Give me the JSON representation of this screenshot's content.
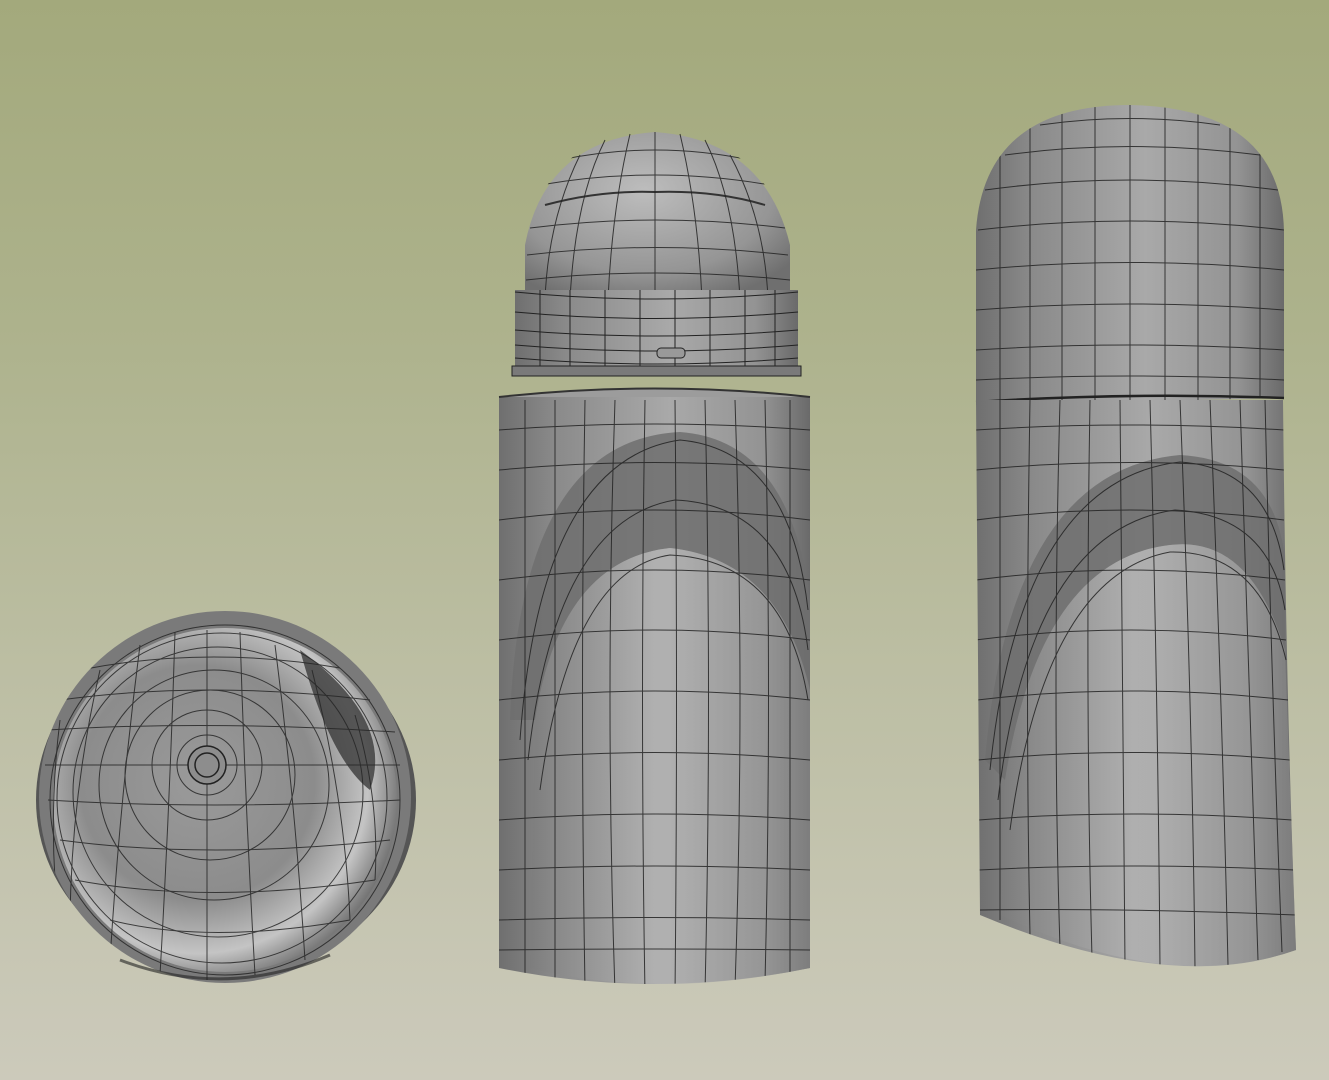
{
  "scene": {
    "objects": [
      {
        "name": "cap-interior-view"
      },
      {
        "name": "roll-on-bottle-open"
      },
      {
        "name": "roll-on-bottle-capped"
      }
    ],
    "colors": {
      "background_top": "#a3a97c",
      "background_bottom": "#cccabb",
      "surface": "#8f8f8f",
      "surface_light": "#b9b9b9",
      "band": "#6e6e6e",
      "wire": "#1e1e1e"
    }
  }
}
